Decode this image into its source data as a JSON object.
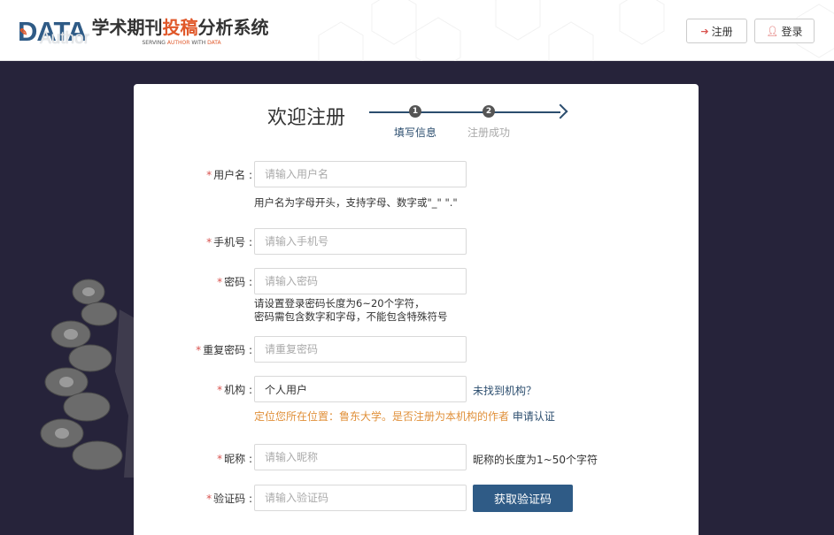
{
  "header": {
    "logo_data": "DATA",
    "logo_author": "Author",
    "title_part1": "学术期刊",
    "title_highlight": "投稿",
    "title_part2": "分析系统",
    "subtitle_part1": "SERVING ",
    "subtitle_highlight": "AUTHOR",
    "subtitle_part2": " WITH ",
    "subtitle_highlight2": "DATA",
    "register_label": "注册",
    "login_label": "登录",
    "register_icon": "sign-in-icon",
    "login_icon": "user-icon"
  },
  "page": {
    "welcome": "欢迎注册",
    "steps": [
      {
        "number": "1",
        "label": "填写信息"
      },
      {
        "number": "2",
        "label": "注册成功"
      }
    ]
  },
  "form": {
    "username": {
      "label": "用户名",
      "placeholder": "请输入用户名",
      "hint": "用户名为字母开头，支持字母、数字或\"_\" \".\""
    },
    "phone": {
      "label": "手机号",
      "placeholder": "请输入手机号"
    },
    "password": {
      "label": "密码",
      "placeholder": "请输入密码",
      "hint_line1": "请设置登录密码长度为6~20个字符，",
      "hint_line2": "密码需包含数字和字母，不能包含特殊符号"
    },
    "confirm_password": {
      "label": "重复密码",
      "placeholder": "请重复密码"
    },
    "institution": {
      "label": "机构",
      "value": "个人用户",
      "not_found_link": "未找到机构？",
      "location_hint": "定位您所在位置：鲁东大学。是否注册为本机构的作者",
      "apply_link": "申请认证"
    },
    "nickname": {
      "label": "昵称",
      "placeholder": "请输入昵称",
      "hint": "昵称的长度为1~50个字符"
    },
    "captcha": {
      "label": "验证码",
      "placeholder": "请输入验证码",
      "button_label": "获取验证码"
    },
    "required_mark": "*",
    "colon": ":"
  },
  "colors": {
    "brand_blue": "#2f5b86",
    "accent_orange": "#e0582a",
    "required_red": "#d9534f",
    "hint_orange": "#e0903a",
    "background_dark": "#26233a"
  }
}
